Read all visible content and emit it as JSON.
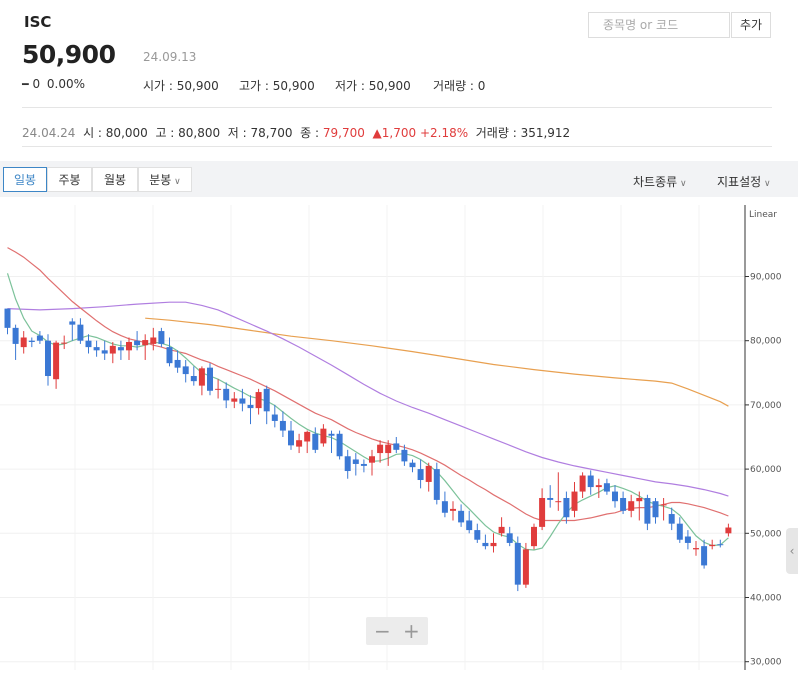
{
  "header": {
    "name": "ISC",
    "price": "50,900",
    "date": "24.09.13",
    "change_sign": "━",
    "change": "0",
    "change_pct": "0.00%",
    "open_label": "시가 : ",
    "open": "50,900",
    "high_label": "고가 : ",
    "high": "50,900",
    "low_label": "저가 : ",
    "low": "50,900",
    "volume_label": "거래량 : ",
    "volume": "0"
  },
  "search": {
    "placeholder": "종목명 or 코드",
    "add_label": "추가"
  },
  "history": {
    "date": "24.04.24",
    "open_label": "시 : ",
    "open": "80,000",
    "high_label": "고 : ",
    "high": "80,800",
    "low_label": "저 : ",
    "low": "78,700",
    "close_label": "종 : ",
    "close": "79,700",
    "change": "▲1,700",
    "change_pct": "+2.18%",
    "volume_label": "거래량 : ",
    "volume": "351,912"
  },
  "toolbar": {
    "tabs": [
      "일봉",
      "주봉",
      "월봉",
      "분봉"
    ],
    "chart_type": "차트종류",
    "indicator": "지표설정"
  },
  "chart_data": {
    "type": "candlestick",
    "scale": "Linear",
    "ylim": [
      30000,
      100000
    ],
    "yticks": [
      30000,
      40000,
      50000,
      60000,
      70000,
      80000,
      90000
    ],
    "ytick_labels": [
      "30,000",
      "40,000",
      "50,000",
      "60,000",
      "70,000",
      "80,000",
      "90,000"
    ],
    "colors": {
      "up": "#e03c3c",
      "down": "#3b78d4",
      "ma5": "#7cc29a",
      "ma20": "#e07070",
      "ma60": "#b07ee0",
      "ma120": "#e8a050"
    },
    "candles": [
      [
        85000,
        85000,
        81000,
        82000
      ],
      [
        82000,
        82500,
        77000,
        79500
      ],
      [
        79000,
        81500,
        78000,
        80500
      ],
      [
        80000,
        80500,
        79000,
        79800
      ],
      [
        80800,
        81500,
        79500,
        80000
      ],
      [
        80000,
        81000,
        73000,
        74500
      ],
      [
        74000,
        80000,
        72500,
        79700
      ],
      [
        79700,
        80800,
        78700,
        79700
      ],
      [
        83000,
        83500,
        80000,
        82500
      ],
      [
        82500,
        83500,
        79500,
        80000
      ],
      [
        80000,
        81000,
        78000,
        79000
      ],
      [
        79000,
        80000,
        77500,
        78500
      ],
      [
        78500,
        80000,
        77000,
        78000
      ],
      [
        78000,
        79800,
        76500,
        79200
      ],
      [
        79000,
        80000,
        77000,
        78500
      ],
      [
        78500,
        80500,
        77000,
        79800
      ],
      [
        80000,
        81500,
        78500,
        79300
      ],
      [
        79300,
        81000,
        77000,
        80100
      ],
      [
        79500,
        82000,
        78500,
        80500
      ],
      [
        81500,
        82000,
        79000,
        79500
      ],
      [
        79000,
        80500,
        76000,
        76500
      ],
      [
        77000,
        78500,
        75000,
        75800
      ],
      [
        76000,
        77000,
        73500,
        74800
      ],
      [
        74500,
        76000,
        73000,
        73700
      ],
      [
        73000,
        76000,
        71500,
        75700
      ],
      [
        75800,
        76500,
        71500,
        72200
      ],
      [
        72500,
        74000,
        71000,
        72500
      ],
      [
        72500,
        73500,
        69500,
        70700
      ],
      [
        70500,
        72000,
        69500,
        71000
      ],
      [
        71000,
        72500,
        69000,
        70200
      ],
      [
        70000,
        71500,
        67000,
        69500
      ],
      [
        69500,
        72500,
        68500,
        72000
      ],
      [
        72500,
        73000,
        67000,
        69000
      ],
      [
        68500,
        70000,
        66500,
        67500
      ],
      [
        67500,
        69000,
        65000,
        66000
      ],
      [
        66000,
        67500,
        63000,
        63700
      ],
      [
        63500,
        65500,
        62500,
        64500
      ],
      [
        64300,
        66000,
        62500,
        65800
      ],
      [
        65500,
        66500,
        62500,
        63000
      ],
      [
        64000,
        67000,
        63500,
        66300
      ],
      [
        65500,
        66000,
        62500,
        65200
      ],
      [
        65500,
        66000,
        61500,
        62000
      ],
      [
        62000,
        63000,
        58500,
        59700
      ],
      [
        61500,
        62500,
        59000,
        60800
      ],
      [
        60800,
        61500,
        59500,
        60500
      ],
      [
        61000,
        63000,
        59000,
        62000
      ],
      [
        62500,
        64500,
        61000,
        63800
      ],
      [
        62500,
        64500,
        60500,
        63800
      ],
      [
        64000,
        65000,
        62500,
        63000
      ],
      [
        63000,
        63800,
        60500,
        61200
      ],
      [
        61000,
        61500,
        59500,
        60300
      ],
      [
        60000,
        61500,
        57000,
        58300
      ],
      [
        58000,
        61000,
        56500,
        60500
      ],
      [
        60000,
        61000,
        54500,
        55200
      ],
      [
        55000,
        56500,
        52500,
        53200
      ],
      [
        53500,
        55000,
        52000,
        53800
      ],
      [
        53500,
        54500,
        51000,
        51700
      ],
      [
        52000,
        53500,
        50000,
        50500
      ],
      [
        50500,
        51500,
        48500,
        49000
      ],
      [
        48500,
        49800,
        47500,
        48000
      ],
      [
        48000,
        50000,
        47000,
        48500
      ],
      [
        50000,
        52500,
        49500,
        51000
      ],
      [
        50000,
        51000,
        48000,
        48500
      ],
      [
        48500,
        49500,
        41000,
        42000
      ],
      [
        42000,
        48500,
        41500,
        47500
      ],
      [
        48000,
        51500,
        47500,
        51000
      ],
      [
        51000,
        57000,
        50500,
        55500
      ],
      [
        55500,
        57500,
        54000,
        55200
      ],
      [
        55000,
        59500,
        53500,
        55000
      ],
      [
        55500,
        56500,
        51500,
        52500
      ],
      [
        53500,
        58000,
        52500,
        56500
      ],
      [
        56500,
        59500,
        55500,
        59000
      ],
      [
        59000,
        59800,
        56000,
        57200
      ],
      [
        57200,
        58500,
        55500,
        57500
      ],
      [
        57800,
        58500,
        56000,
        56500
      ],
      [
        56500,
        57500,
        54000,
        55000
      ],
      [
        55500,
        56500,
        53000,
        53500
      ],
      [
        53500,
        56000,
        52500,
        55000
      ],
      [
        55000,
        56500,
        52000,
        55500
      ],
      [
        55500,
        56000,
        50500,
        51500
      ],
      [
        55000,
        55500,
        51500,
        52500
      ],
      [
        54500,
        55500,
        52000,
        54500
      ],
      [
        53000,
        54000,
        50500,
        51500
      ],
      [
        51500,
        52500,
        48500,
        49000
      ],
      [
        49500,
        50500,
        47500,
        48500
      ],
      [
        47500,
        48800,
        46500,
        47700
      ],
      [
        48000,
        49000,
        44500,
        45000
      ],
      [
        48000,
        49000,
        47500,
        48200
      ],
      [
        48300,
        49000,
        47800,
        48200
      ],
      [
        50000,
        51500,
        49500,
        50900
      ]
    ],
    "ma5": [
      [
        0,
        90500
      ],
      [
        1,
        86500
      ],
      [
        2,
        83500
      ],
      [
        3,
        81500
      ],
      [
        4,
        80800
      ],
      [
        5,
        79800
      ],
      [
        6,
        79300
      ],
      [
        7,
        79500
      ],
      [
        8,
        80000
      ],
      [
        9,
        80400
      ],
      [
        10,
        80800
      ],
      [
        11,
        80500
      ],
      [
        12,
        80000
      ],
      [
        13,
        79500
      ],
      [
        14,
        79200
      ],
      [
        15,
        79200
      ],
      [
        16,
        79000
      ],
      [
        17,
        79300
      ],
      [
        18,
        79800
      ],
      [
        19,
        79600
      ],
      [
        20,
        79200
      ],
      [
        21,
        78400
      ],
      [
        22,
        77300
      ],
      [
        23,
        76100
      ],
      [
        24,
        75000
      ],
      [
        25,
        74500
      ],
      [
        26,
        74000
      ],
      [
        27,
        73300
      ],
      [
        28,
        72600
      ],
      [
        29,
        72000
      ],
      [
        30,
        71300
      ],
      [
        31,
        71000
      ],
      [
        32,
        70600
      ],
      [
        33,
        69900
      ],
      [
        34,
        68900
      ],
      [
        35,
        67900
      ],
      [
        36,
        67000
      ],
      [
        37,
        66200
      ],
      [
        38,
        65600
      ],
      [
        39,
        65200
      ],
      [
        40,
        64900
      ],
      [
        41,
        64300
      ],
      [
        42,
        63500
      ],
      [
        43,
        62700
      ],
      [
        44,
        61900
      ],
      [
        45,
        61200
      ],
      [
        46,
        61300
      ],
      [
        47,
        61700
      ],
      [
        48,
        62300
      ],
      [
        49,
        62400
      ],
      [
        50,
        62100
      ],
      [
        51,
        61500
      ],
      [
        52,
        60600
      ],
      [
        53,
        59600
      ],
      [
        54,
        58200
      ],
      [
        55,
        56600
      ],
      [
        56,
        55000
      ],
      [
        57,
        53800
      ],
      [
        58,
        52500
      ],
      [
        59,
        51200
      ],
      [
        60,
        50200
      ],
      [
        61,
        49700
      ],
      [
        62,
        49400
      ],
      [
        63,
        48300
      ],
      [
        64,
        47500
      ],
      [
        65,
        47400
      ],
      [
        66,
        47700
      ],
      [
        67,
        49500
      ],
      [
        68,
        51500
      ],
      [
        69,
        53200
      ],
      [
        70,
        54500
      ],
      [
        71,
        55200
      ],
      [
        72,
        55800
      ],
      [
        73,
        56400
      ],
      [
        74,
        57100
      ],
      [
        75,
        57400
      ],
      [
        76,
        57000
      ],
      [
        77,
        56500
      ],
      [
        78,
        55800
      ],
      [
        79,
        55000
      ],
      [
        80,
        54500
      ],
      [
        81,
        54200
      ],
      [
        82,
        53800
      ],
      [
        83,
        52800
      ],
      [
        84,
        51200
      ],
      [
        85,
        49600
      ],
      [
        86,
        48600
      ],
      [
        87,
        48100
      ],
      [
        88,
        48200
      ],
      [
        89,
        49300
      ]
    ],
    "ma20": [
      [
        0,
        94500
      ],
      [
        1,
        93800
      ],
      [
        2,
        93000
      ],
      [
        3,
        92000
      ],
      [
        4,
        91000
      ],
      [
        5,
        89700
      ],
      [
        6,
        88500
      ],
      [
        7,
        87300
      ],
      [
        8,
        86100
      ],
      [
        9,
        85100
      ],
      [
        10,
        84100
      ],
      [
        11,
        83100
      ],
      [
        12,
        82200
      ],
      [
        13,
        81400
      ],
      [
        14,
        80800
      ],
      [
        15,
        80300
      ],
      [
        16,
        80000
      ],
      [
        17,
        79700
      ],
      [
        18,
        79300
      ],
      [
        19,
        79000
      ],
      [
        20,
        78600
      ],
      [
        21,
        78300
      ],
      [
        22,
        78000
      ],
      [
        23,
        77500
      ],
      [
        24,
        77000
      ],
      [
        25,
        76600
      ],
      [
        26,
        76000
      ],
      [
        27,
        75500
      ],
      [
        28,
        75000
      ],
      [
        29,
        74500
      ],
      [
        30,
        74000
      ],
      [
        31,
        73400
      ],
      [
        32,
        72800
      ],
      [
        33,
        72200
      ],
      [
        34,
        71500
      ],
      [
        35,
        70800
      ],
      [
        36,
        70100
      ],
      [
        37,
        69400
      ],
      [
        38,
        68700
      ],
      [
        39,
        68200
      ],
      [
        40,
        67700
      ],
      [
        41,
        67000
      ],
      [
        42,
        66300
      ],
      [
        43,
        65700
      ],
      [
        44,
        65200
      ],
      [
        45,
        64700
      ],
      [
        46,
        64300
      ],
      [
        47,
        64000
      ],
      [
        48,
        63700
      ],
      [
        49,
        63400
      ],
      [
        50,
        63000
      ],
      [
        51,
        62500
      ],
      [
        52,
        61900
      ],
      [
        53,
        61300
      ],
      [
        54,
        60600
      ],
      [
        55,
        59800
      ],
      [
        56,
        59000
      ],
      [
        57,
        58300
      ],
      [
        58,
        57500
      ],
      [
        59,
        56800
      ],
      [
        60,
        56000
      ],
      [
        61,
        55300
      ],
      [
        62,
        54600
      ],
      [
        63,
        53800
      ],
      [
        64,
        53000
      ],
      [
        65,
        52400
      ],
      [
        66,
        52000
      ],
      [
        67,
        52000
      ],
      [
        68,
        52000
      ],
      [
        69,
        52000
      ],
      [
        70,
        52000
      ],
      [
        71,
        52200
      ],
      [
        72,
        52400
      ],
      [
        73,
        52700
      ],
      [
        74,
        53000
      ],
      [
        75,
        53200
      ],
      [
        76,
        53600
      ],
      [
        77,
        53900
      ],
      [
        78,
        54000
      ],
      [
        79,
        54000
      ],
      [
        80,
        54200
      ],
      [
        81,
        54500
      ],
      [
        82,
        54800
      ],
      [
        83,
        54800
      ],
      [
        84,
        54600
      ],
      [
        85,
        54300
      ],
      [
        86,
        54000
      ],
      [
        87,
        53600
      ],
      [
        88,
        53200
      ],
      [
        89,
        52700
      ]
    ],
    "ma60": [
      [
        0,
        85000
      ],
      [
        4,
        84800
      ],
      [
        8,
        85000
      ],
      [
        12,
        85300
      ],
      [
        16,
        85700
      ],
      [
        20,
        86000
      ],
      [
        22,
        86000
      ],
      [
        24,
        85500
      ],
      [
        26,
        84800
      ],
      [
        28,
        83700
      ],
      [
        30,
        82600
      ],
      [
        32,
        81500
      ],
      [
        34,
        80300
      ],
      [
        36,
        79000
      ],
      [
        38,
        77600
      ],
      [
        40,
        76200
      ],
      [
        42,
        74700
      ],
      [
        44,
        73200
      ],
      [
        46,
        71800
      ],
      [
        48,
        70600
      ],
      [
        50,
        69600
      ],
      [
        52,
        68700
      ],
      [
        54,
        67700
      ],
      [
        56,
        66700
      ],
      [
        58,
        65700
      ],
      [
        60,
        64700
      ],
      [
        62,
        63700
      ],
      [
        64,
        62700
      ],
      [
        66,
        61800
      ],
      [
        68,
        61100
      ],
      [
        70,
        60500
      ],
      [
        72,
        60000
      ],
      [
        74,
        59500
      ],
      [
        76,
        59000
      ],
      [
        78,
        58500
      ],
      [
        80,
        58000
      ],
      [
        82,
        57700
      ],
      [
        84,
        57300
      ],
      [
        86,
        56800
      ],
      [
        88,
        56200
      ],
      [
        89,
        55800
      ]
    ],
    "ma120": [
      [
        17,
        83500
      ],
      [
        20,
        83200
      ],
      [
        25,
        82500
      ],
      [
        30,
        81600
      ],
      [
        35,
        80700
      ],
      [
        40,
        80000
      ],
      [
        45,
        79200
      ],
      [
        50,
        78300
      ],
      [
        55,
        77300
      ],
      [
        60,
        76300
      ],
      [
        65,
        75500
      ],
      [
        70,
        74800
      ],
      [
        75,
        74200
      ],
      [
        80,
        73700
      ],
      [
        82,
        73400
      ],
      [
        84,
        72500
      ],
      [
        86,
        71500
      ],
      [
        88,
        70500
      ],
      [
        89,
        69800
      ]
    ]
  }
}
